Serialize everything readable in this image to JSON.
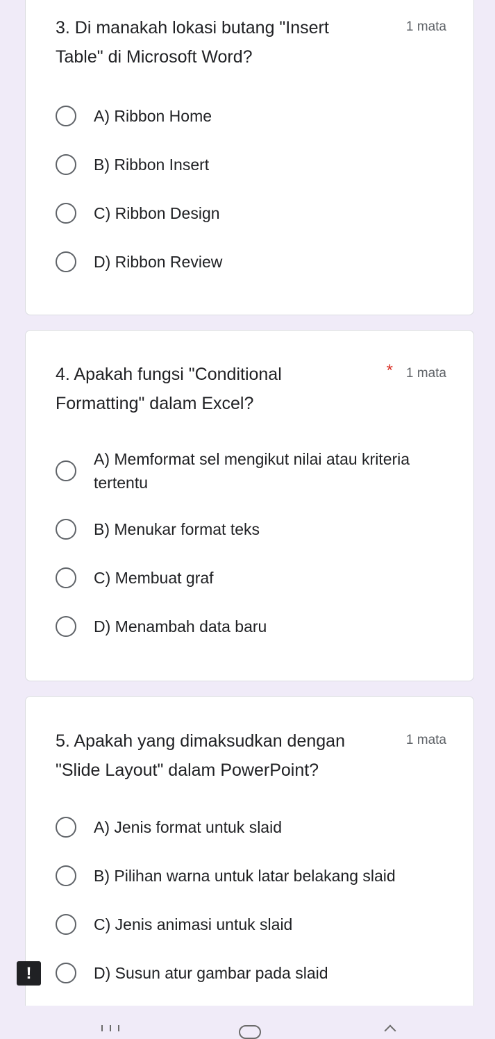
{
  "questions": [
    {
      "title": "3. Di manakah lokasi butang \"Insert Table\" di Microsoft Word?",
      "points": "1 mata",
      "required": "",
      "options": [
        "A) Ribbon Home",
        "B) Ribbon Insert",
        "C) Ribbon Design",
        "D) Ribbon Review"
      ]
    },
    {
      "title": "4. Apakah fungsi \"Conditional Formatting\" dalam Excel?",
      "points": "1 mata",
      "required": "*",
      "options": [
        "A) Memformat sel mengikut nilai atau kriteria tertentu",
        "B) Menukar format teks",
        "C) Membuat graf",
        "D) Menambah data baru"
      ]
    },
    {
      "title": "5. Apakah yang dimaksudkan dengan \"Slide Layout\" dalam PowerPoint?",
      "points": "1 mata",
      "required": "",
      "options": [
        "A) Jenis format untuk slaid",
        "B) Pilihan warna untuk latar belakang slaid",
        "C) Jenis animasi untuk slaid",
        "D) Susun atur gambar pada slaid"
      ]
    }
  ],
  "alert": {
    "symbol": "!",
    "icon": "alert-icon"
  },
  "navbar": {
    "icons": [
      "recent-apps-icon",
      "home-icon",
      "back-icon"
    ]
  },
  "colors": {
    "page_background": "#f0ebf8",
    "card_background": "#ffffff",
    "required_star": "#d93025",
    "secondary_text": "#5f6368"
  }
}
